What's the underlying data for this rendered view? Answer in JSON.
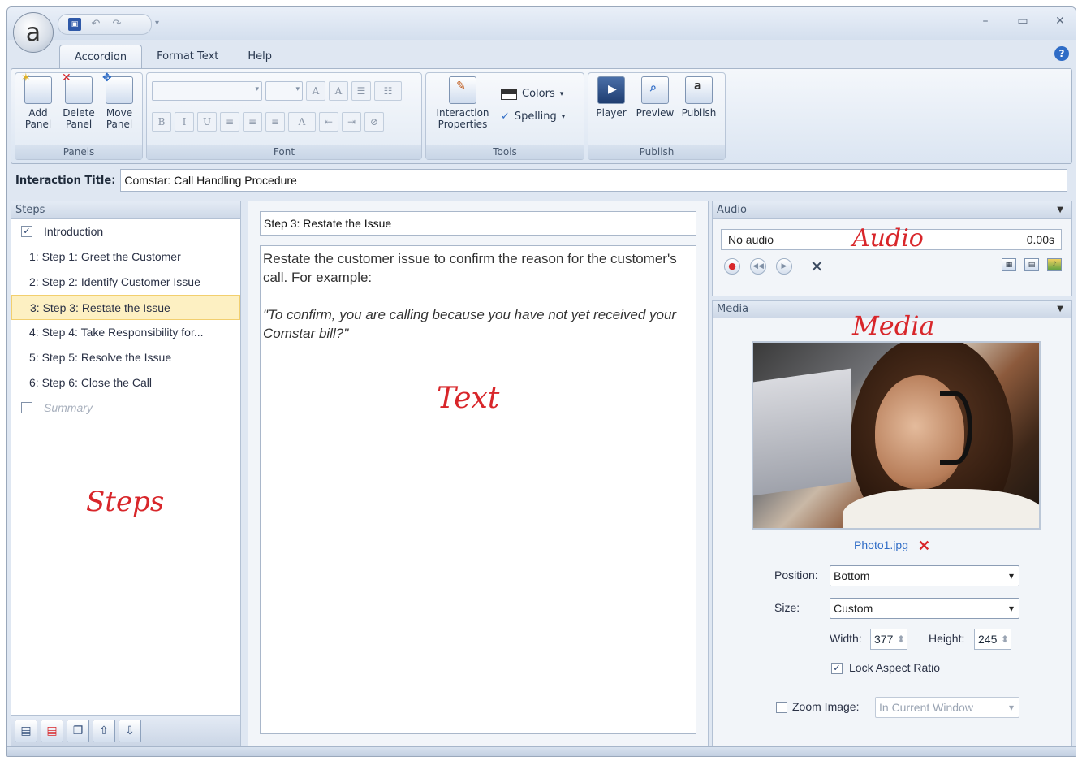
{
  "app": {
    "orb_glyph": "a",
    "quick_access": [
      "save-icon",
      "undo-icon",
      "redo-icon"
    ],
    "window_controls": [
      "–",
      "▭",
      "✕"
    ]
  },
  "tabs": [
    {
      "label": "Accordion",
      "active": true
    },
    {
      "label": "Format Text",
      "active": false
    },
    {
      "label": "Help",
      "active": false
    }
  ],
  "ribbon": {
    "panels": {
      "label": "Panels",
      "add": "Add Panel",
      "delete": "Delete Panel",
      "move": "Move Panel"
    },
    "font": {
      "label": "Font"
    },
    "tools": {
      "label": "Tools",
      "interaction_properties": "Interaction Properties",
      "colors": "Colors",
      "spelling": "Spelling"
    },
    "publish": {
      "label": "Publish",
      "player": "Player",
      "preview": "Preview",
      "publish": "Publish"
    }
  },
  "interaction": {
    "label": "Interaction Title:",
    "value": "Comstar: Call Handling Procedure"
  },
  "steps": {
    "header": "Steps",
    "items": [
      {
        "label": "Introduction",
        "checkbox": true,
        "checked": true
      },
      {
        "label": "1:  Step 1: Greet the Customer"
      },
      {
        "label": "2:  Step 2: Identify Customer Issue"
      },
      {
        "label": "3:  Step 3: Restate the Issue",
        "selected": true
      },
      {
        "label": "4:  Step 4:  Take Responsibility  for..."
      },
      {
        "label": "5:  Step 5: Resolve the Issue"
      },
      {
        "label": "6:  Step 6: Close the Call"
      },
      {
        "label": "Summary",
        "checkbox": true,
        "checked": false,
        "dim": true
      }
    ],
    "annotation": "Steps"
  },
  "text": {
    "step_title": "Step 3: Restate the Issue",
    "body": "Restate the customer issue to confirm the reason for the customer's call. For example:",
    "quote": "\"To confirm, you are calling because you have not yet received your Comstar bill?\"",
    "annotation": "Text"
  },
  "audio": {
    "header": "Audio",
    "status": "No audio",
    "time": "0.00s",
    "annotation": "Audio"
  },
  "media": {
    "header": "Media",
    "annotation": "Media",
    "filename": "Photo1.jpg",
    "position_label": "Position:",
    "position_value": "Bottom",
    "size_label": "Size:",
    "size_value": "Custom",
    "width_label": "Width:",
    "width_value": "377",
    "height_label": "Height:",
    "height_value": "245",
    "lock_label": "Lock Aspect Ratio",
    "lock_checked": true,
    "zoom_label": "Zoom Image:",
    "zoom_checked": false,
    "zoom_value": "In Current Window"
  },
  "colors": {
    "accent": "#2f6cc6",
    "annotation": "#d8262a",
    "selection": "#fdf0c2"
  }
}
